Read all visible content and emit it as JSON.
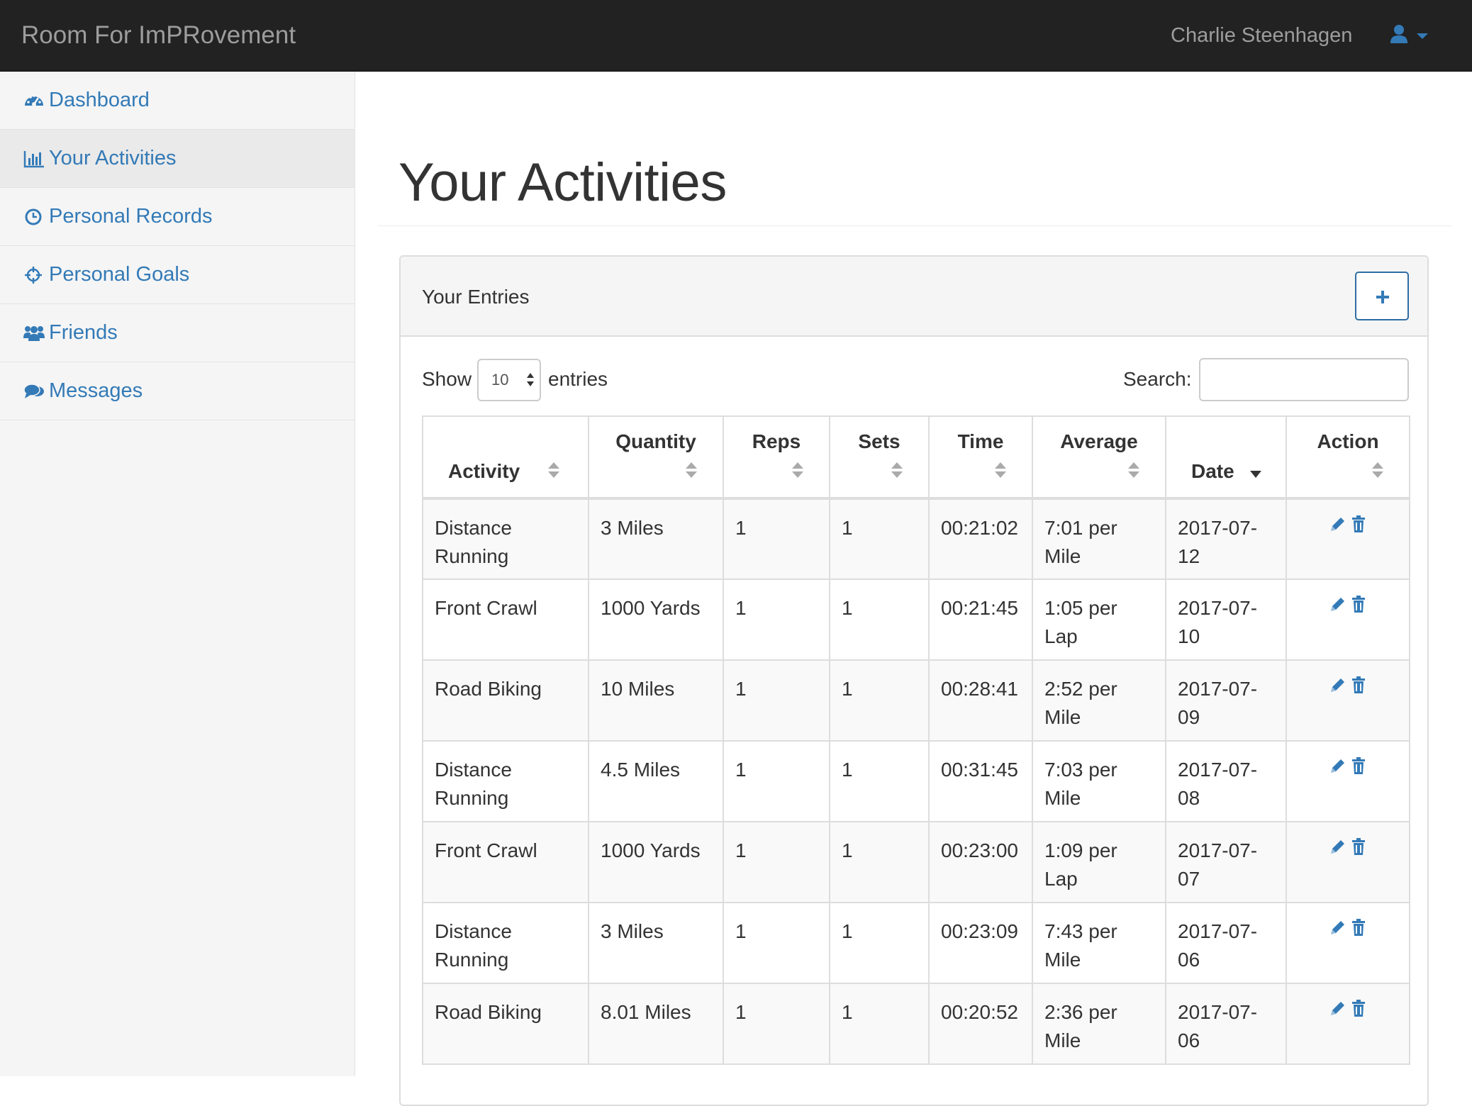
{
  "navbar": {
    "brand": "Room For ImPRovement",
    "user_name": "Charlie Steenhagen",
    "user_icon": "user-icon",
    "accent_color": "#337ab7"
  },
  "sidebar": {
    "items": [
      {
        "label": "Dashboard",
        "icon": "dashboard-icon",
        "active": false
      },
      {
        "label": "Your Activities",
        "icon": "bar-chart-icon",
        "active": true
      },
      {
        "label": "Personal Records",
        "icon": "clock-icon",
        "active": false
      },
      {
        "label": "Personal Goals",
        "icon": "crosshairs-icon",
        "active": false
      },
      {
        "label": "Friends",
        "icon": "users-icon",
        "active": false
      },
      {
        "label": "Messages",
        "icon": "comments-icon",
        "active": false
      }
    ]
  },
  "main": {
    "title": "Your Activities",
    "panel": {
      "title": "Your Entries",
      "add_icon": "plus-icon"
    },
    "length": {
      "show_label": "Show",
      "value": "10",
      "entries_label": "entries"
    },
    "search": {
      "label": "Search:",
      "value": ""
    },
    "table": {
      "columns": [
        "Activity",
        "Quantity",
        "Reps",
        "Sets",
        "Time",
        "Average",
        "Date",
        "Action"
      ],
      "sorted_column": "Date",
      "sort_direction": "desc",
      "rows": [
        {
          "activity": "Distance Running",
          "quantity": "3 Miles",
          "reps": "1",
          "sets": "1",
          "time": "00:21:02",
          "average": "7:01 per Mile",
          "date": "2017-07-12"
        },
        {
          "activity": "Front Crawl",
          "quantity": "1000 Yards",
          "reps": "1",
          "sets": "1",
          "time": "00:21:45",
          "average": "1:05 per Lap",
          "date": "2017-07-10"
        },
        {
          "activity": "Road Biking",
          "quantity": "10 Miles",
          "reps": "1",
          "sets": "1",
          "time": "00:28:41",
          "average": "2:52 per Mile",
          "date": "2017-07-09"
        },
        {
          "activity": "Distance Running",
          "quantity": "4.5 Miles",
          "reps": "1",
          "sets": "1",
          "time": "00:31:45",
          "average": "7:03 per Mile",
          "date": "2017-07-08"
        },
        {
          "activity": "Front Crawl",
          "quantity": "1000 Yards",
          "reps": "1",
          "sets": "1",
          "time": "00:23:00",
          "average": "1:09 per Lap",
          "date": "2017-07-07"
        },
        {
          "activity": "Distance Running",
          "quantity": "3 Miles",
          "reps": "1",
          "sets": "1",
          "time": "00:23:09",
          "average": "7:43 per Mile",
          "date": "2017-07-06"
        },
        {
          "activity": "Road Biking",
          "quantity": "8.01 Miles",
          "reps": "1",
          "sets": "1",
          "time": "00:20:52",
          "average": "2:36 per Mile",
          "date": "2017-07-06"
        }
      ],
      "action_icons": [
        "pencil-icon",
        "trash-icon"
      ]
    }
  }
}
